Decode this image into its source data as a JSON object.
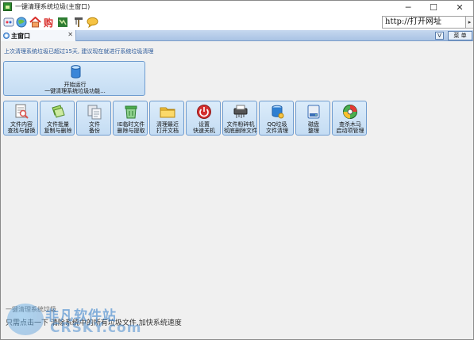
{
  "window": {
    "title": "一键清理系统垃圾(主窗口)",
    "minimize": "─",
    "maximize": "☐",
    "close": "✕"
  },
  "toolbar": {
    "icons": [
      "settings-icon",
      "globe-icon",
      "home-icon",
      "shop-icon",
      "map-icon",
      "tools-icon",
      "chat-icon"
    ],
    "shop_label": "购",
    "url_value": "http://打开网址",
    "go_label": "▸"
  },
  "tabs": {
    "main_label": "主窗口",
    "close_label": "✕",
    "dropdown_label": "V",
    "menu_label": "菜 单"
  },
  "notice": "上次清理系统垃圾已超过15天, 建议现在就进行系统垃圾清理",
  "big_button": {
    "line1": "开始运行",
    "line2": "一键清理系统垃圾功能...",
    "icon": "database-icon"
  },
  "tiles": [
    {
      "l1": "文件内容",
      "l2": "查找与替换",
      "icon": "doc-search-icon",
      "color": "#d9534f"
    },
    {
      "l1": "文件批量",
      "l2": "复制与删除",
      "icon": "copy-icon",
      "color": "#7ab648"
    },
    {
      "l1": "文件",
      "l2": "备份",
      "icon": "backup-icon",
      "color": "#9aa5b1"
    },
    {
      "l1": "IE临时文件",
      "l2": "删除与提取",
      "icon": "recycle-icon",
      "color": "#4caf50"
    },
    {
      "l1": "清理最近",
      "l2": "打开文档",
      "icon": "folder-icon",
      "color": "#f5c542"
    },
    {
      "l1": "设置",
      "l2": "快速关机",
      "icon": "power-icon",
      "color": "#d32f2f"
    },
    {
      "l1": "文件粉碎机",
      "l2": "彻底删除文件",
      "icon": "shredder-icon",
      "color": "#444444"
    },
    {
      "l1": "QQ垃圾",
      "l2": "文件清理",
      "icon": "qq-icon",
      "color": "#2f7fd1"
    },
    {
      "l1": "磁盘",
      "l2": "整理",
      "icon": "disk-icon",
      "color": "#3b6fb6"
    },
    {
      "l1": "查杀木马",
      "l2": "启动项管理",
      "icon": "shield-icon",
      "color": "#e53935"
    }
  ],
  "tip": {
    "title": "一键清理系统垃圾",
    "body": "只需点击一下 清除系统中的所有垃圾文件,加快系统速度"
  },
  "watermark": {
    "cn": "非凡软件站",
    "en": "CRSKY.com"
  }
}
